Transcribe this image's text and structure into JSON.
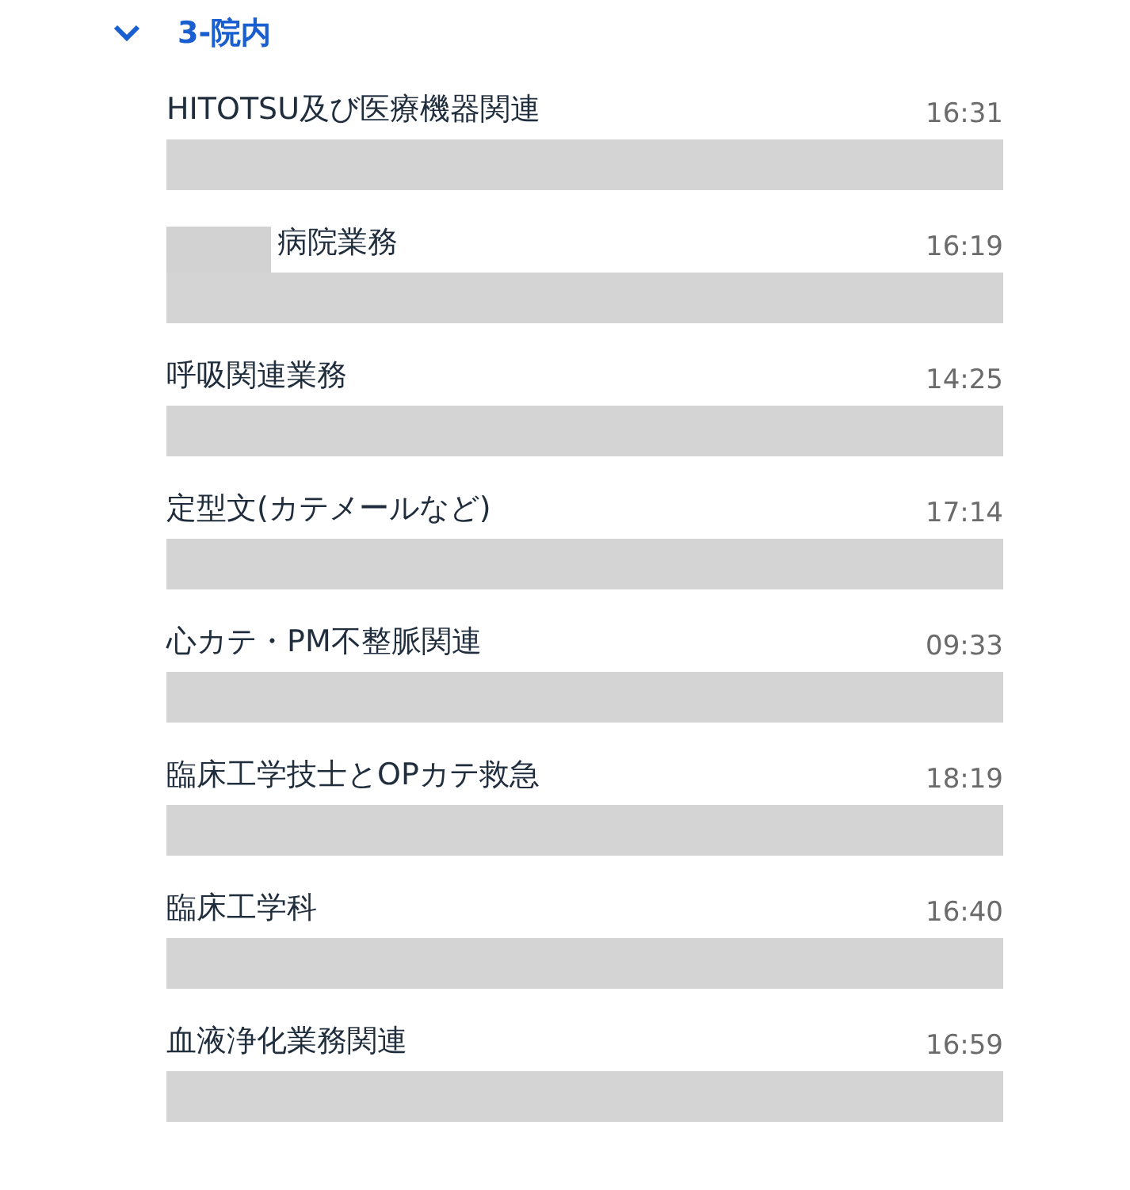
{
  "group": {
    "title": "3-院内",
    "expanded": true
  },
  "chats": [
    {
      "name": "HITOTSU及び医療機器関連",
      "time": "16:31",
      "redacted_prefix": false
    },
    {
      "name": "病院業務",
      "time": "16:19",
      "redacted_prefix": true
    },
    {
      "name": "呼吸関連業務",
      "time": "14:25",
      "redacted_prefix": false
    },
    {
      "name": "定型文(カテメールなど)",
      "time": "17:14",
      "redacted_prefix": false
    },
    {
      "name": "心カテ・PM不整脈関連",
      "time": "09:33",
      "redacted_prefix": false
    },
    {
      "name": "臨床工学技士とOPカテ救急",
      "time": "18:19",
      "redacted_prefix": false
    },
    {
      "name": "臨床工学科",
      "time": "16:40",
      "redacted_prefix": false
    },
    {
      "name": "血液浄化業務関連",
      "time": "16:59",
      "redacted_prefix": false
    }
  ]
}
